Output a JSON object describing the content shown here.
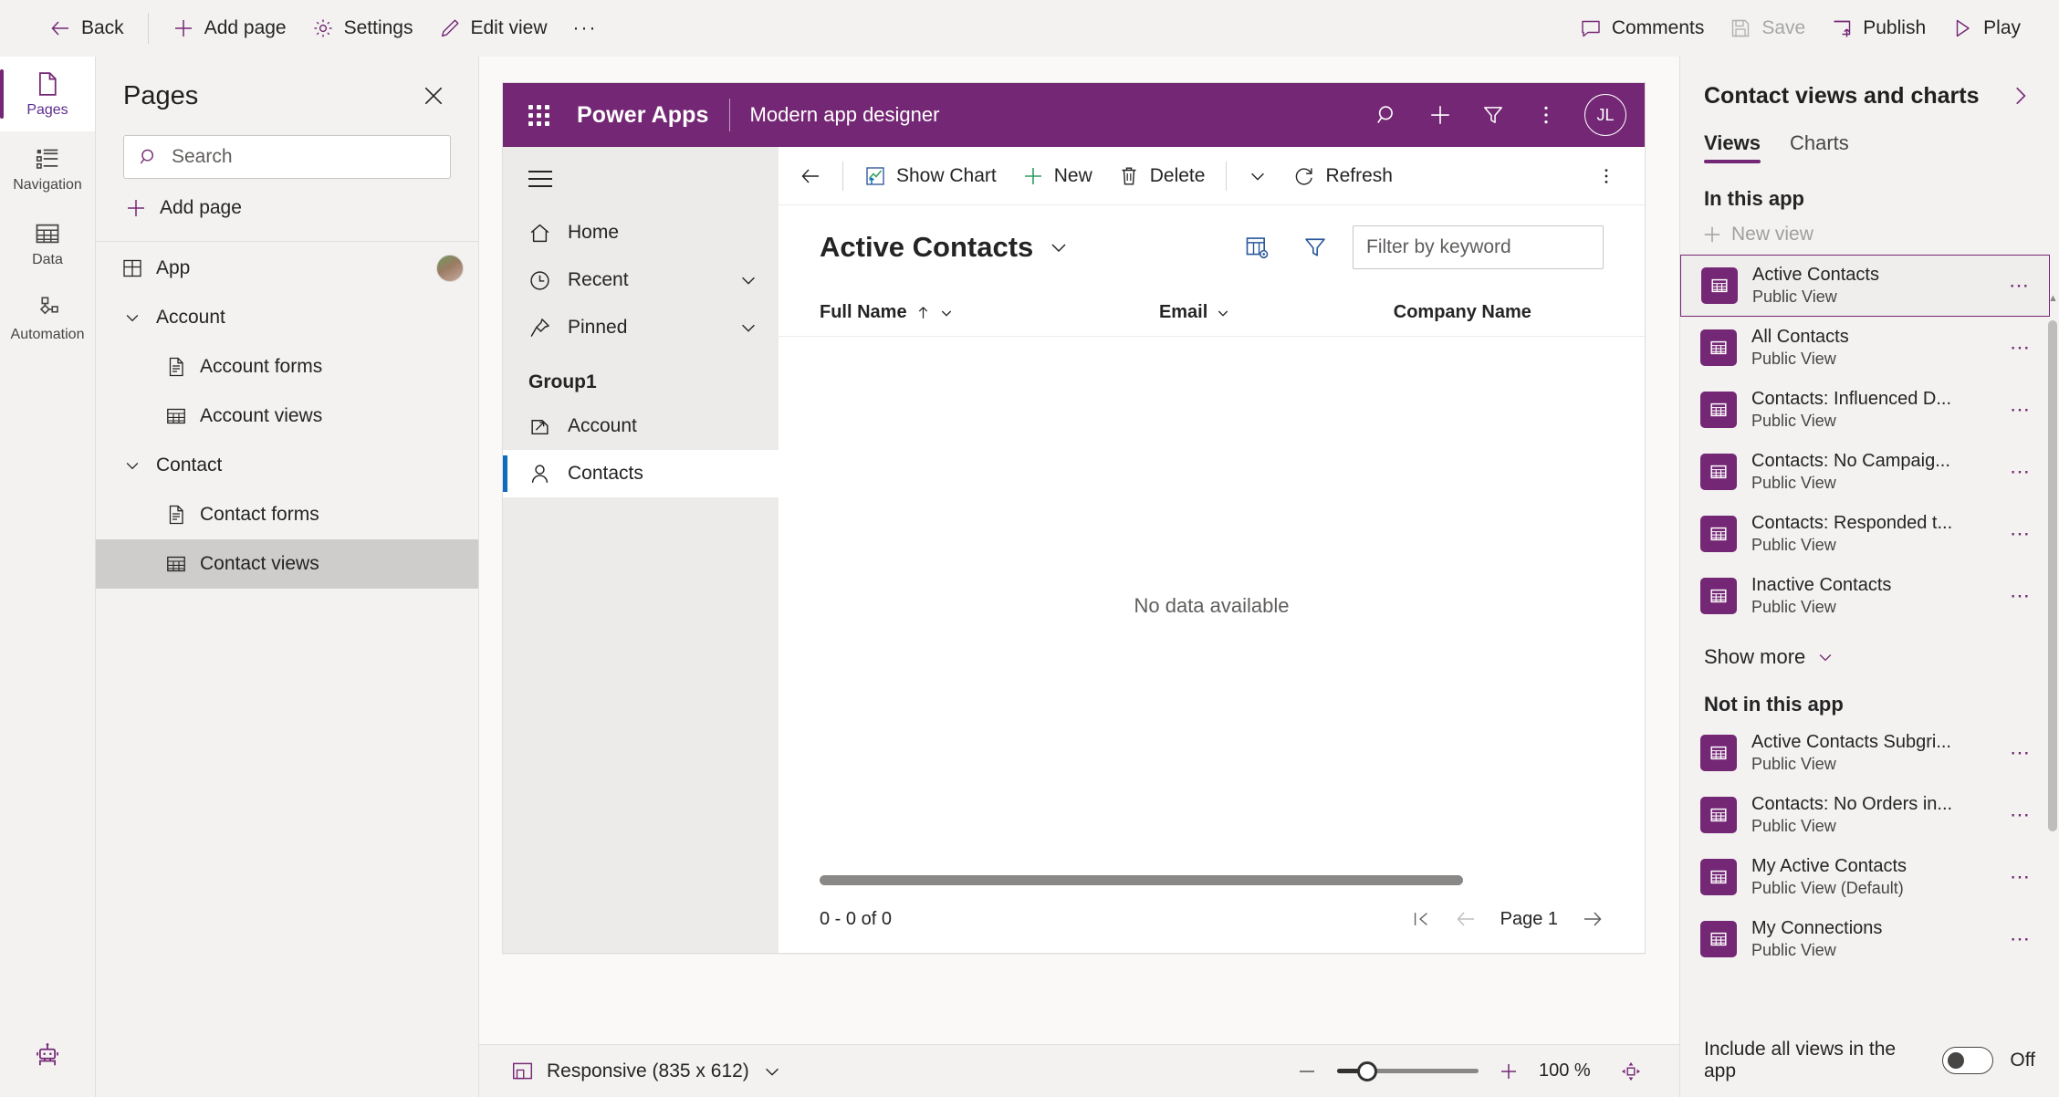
{
  "topbar": {
    "back": "Back",
    "add_page": "Add page",
    "settings": "Settings",
    "edit_view": "Edit view",
    "overflow": "···",
    "comments": "Comments",
    "save": "Save",
    "publish": "Publish",
    "play": "Play"
  },
  "rail": {
    "items": [
      {
        "label": "Pages",
        "icon": "page-icon"
      },
      {
        "label": "Navigation",
        "icon": "navigation-icon"
      },
      {
        "label": "Data",
        "icon": "data-table-icon"
      },
      {
        "label": "Automation",
        "icon": "automation-icon"
      }
    ],
    "bottom_icon": "copilot-robot-icon"
  },
  "pages_panel": {
    "title": "Pages",
    "search_placeholder": "Search",
    "search_value": "",
    "add_page": "Add page",
    "tree": [
      {
        "label": "App",
        "icon": "app-icon",
        "level": 1,
        "avatar": true,
        "selected": false,
        "chevron": ""
      },
      {
        "label": "Account",
        "icon": "",
        "level": 1,
        "avatar": false,
        "selected": false,
        "chevron": "down"
      },
      {
        "label": "Account forms",
        "icon": "form-icon",
        "level": 2,
        "avatar": false,
        "selected": false,
        "chevron": ""
      },
      {
        "label": "Account views",
        "icon": "grid-icon",
        "level": 2,
        "avatar": false,
        "selected": false,
        "chevron": ""
      },
      {
        "label": "Contact",
        "icon": "",
        "level": 1,
        "avatar": false,
        "selected": false,
        "chevron": "down"
      },
      {
        "label": "Contact forms",
        "icon": "form-icon",
        "level": 2,
        "avatar": false,
        "selected": false,
        "chevron": ""
      },
      {
        "label": "Contact views",
        "icon": "grid-icon",
        "level": 2,
        "avatar": false,
        "selected": true,
        "chevron": ""
      }
    ]
  },
  "canvas": {
    "pa_header": {
      "brand": "Power Apps",
      "subtitle": "Modern app designer",
      "avatar_initials": "JL"
    },
    "app_nav": {
      "items": [
        {
          "label": "Home",
          "icon": "home-icon",
          "chevron": false,
          "active": false
        },
        {
          "label": "Recent",
          "icon": "clock-icon",
          "chevron": true,
          "active": false
        },
        {
          "label": "Pinned",
          "icon": "pin-icon",
          "chevron": true,
          "active": false
        }
      ],
      "group_label": "Group1",
      "group_items": [
        {
          "label": "Account",
          "icon": "account-icon",
          "active": false
        },
        {
          "label": "Contacts",
          "icon": "contact-person-icon",
          "active": true
        }
      ]
    },
    "command_bar": {
      "show_chart": "Show Chart",
      "new": "New",
      "delete": "Delete",
      "refresh": "Refresh"
    },
    "view": {
      "title": "Active Contacts",
      "filter_placeholder": "Filter by keyword",
      "filter_value": "",
      "columns": [
        "Full Name",
        "Email",
        "Company Name"
      ],
      "sorted_column": "Full Name",
      "sort_direction": "asc",
      "empty_message": "No data available",
      "record_count": "0 - 0 of 0",
      "page_label": "Page 1"
    }
  },
  "statusbar": {
    "responsive": "Responsive (835 x 612)",
    "zoom_percent": "100 %"
  },
  "right_panel": {
    "title": "Contact views and charts",
    "tabs": [
      {
        "label": "Views",
        "active": true
      },
      {
        "label": "Charts",
        "active": false
      }
    ],
    "in_this_app_label": "In this app",
    "new_view_label": "New view",
    "in_this_app": [
      {
        "name": "Active Contacts",
        "subtitle": "Public View",
        "selected": true
      },
      {
        "name": "All Contacts",
        "subtitle": "Public View",
        "selected": false
      },
      {
        "name": "Contacts: Influenced D...",
        "subtitle": "Public View",
        "selected": false
      },
      {
        "name": "Contacts: No Campaig...",
        "subtitle": "Public View",
        "selected": false
      },
      {
        "name": "Contacts: Responded t...",
        "subtitle": "Public View",
        "selected": false
      },
      {
        "name": "Inactive Contacts",
        "subtitle": "Public View",
        "selected": false
      }
    ],
    "show_more": "Show more",
    "not_in_this_app_label": "Not in this app",
    "not_in_this_app": [
      {
        "name": "Active Contacts Subgri...",
        "subtitle": "Public View",
        "selected": false
      },
      {
        "name": "Contacts: No Orders in...",
        "subtitle": "Public View",
        "selected": false
      },
      {
        "name": "My Active Contacts",
        "subtitle": "Public View (Default)",
        "selected": false
      },
      {
        "name": "My Connections",
        "subtitle": "Public View",
        "selected": false
      }
    ],
    "include_all_label": "Include all views in the app",
    "include_all_state": "Off"
  },
  "colors": {
    "brand_purple": "#742774",
    "header_purple": "#742774",
    "accent_blue": "#0f6cbd",
    "panel_bg": "#f3f2f1"
  }
}
